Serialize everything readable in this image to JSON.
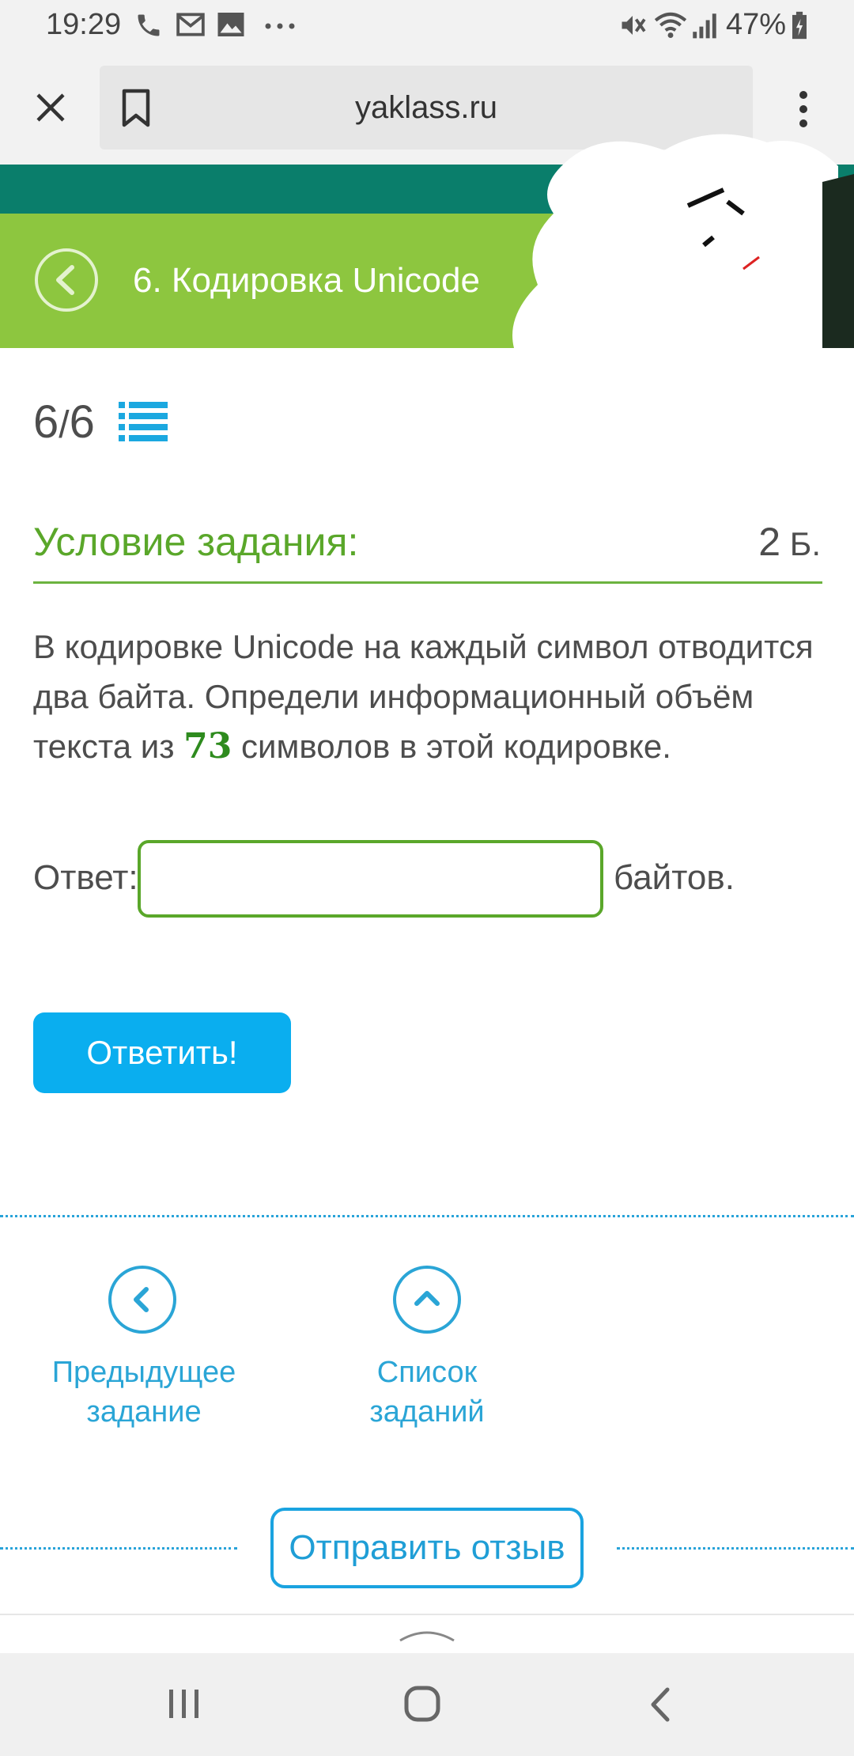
{
  "status_bar": {
    "time": "19:29",
    "battery": "47%",
    "icons": [
      "phone-icon",
      "mail-icon",
      "image-icon",
      "more-dots-icon",
      "mute-icon",
      "wifi-icon",
      "signal-icon",
      "battery-icon"
    ]
  },
  "browser": {
    "url": "yaklass.ru",
    "icons": [
      "close-icon",
      "bookmark-icon",
      "menu-kebab-icon"
    ]
  },
  "header": {
    "title": "6. Кодировка Unicode",
    "back_icon": "back-circle-icon"
  },
  "counter": {
    "current": "6",
    "slash": "/",
    "total": "6",
    "icon": "list-icon"
  },
  "condition": {
    "title": "Условие задания:",
    "points": "2",
    "points_unit": " Б."
  },
  "task": {
    "text_part1": "В кодировке Unicode на каждый символ отводится два байта. Определи информационный объём текста из ",
    "number": "73",
    "text_part2": " символов в этой кодировке."
  },
  "answer": {
    "label": "Ответ:",
    "value": "",
    "unit": "байтов."
  },
  "submit_label": "Ответить!",
  "navigation": {
    "prev_line1": "Предыдущее",
    "prev_line2": "задание",
    "list_label": "Список заданий"
  },
  "feedback_label": "Отправить отзыв",
  "colors": {
    "green": "#8dc63f",
    "dark_green": "#0a7e6b",
    "accent_blue": "#0aaeef",
    "title_green": "#5aa72a"
  }
}
